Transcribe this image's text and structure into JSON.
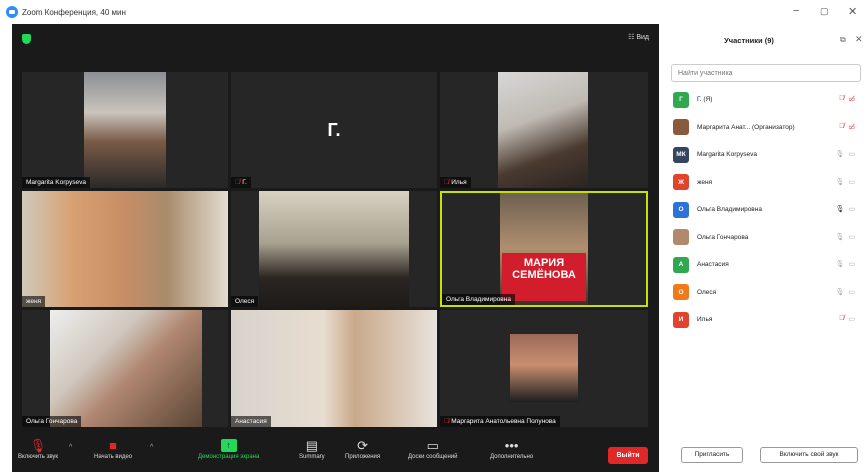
{
  "window": {
    "title": "Zoom Конференция, 40 мин"
  },
  "video_area": {
    "view_label": "Вид"
  },
  "tiles": [
    {
      "name": "Margarita Korpyseva",
      "muted": false
    },
    {
      "name": "Г.",
      "letter": "Г.",
      "muted": true
    },
    {
      "name": "Илья",
      "muted": true
    },
    {
      "name": "женя",
      "muted": false
    },
    {
      "name": "Олеся",
      "muted": false
    },
    {
      "name": "Ольга Владимировна",
      "muted": false,
      "banner_line1": "МАРИЯ",
      "banner_line2": "СЕМЁНОВА"
    },
    {
      "name": "Ольга Гончарова",
      "muted": false
    },
    {
      "name": "Анастасия",
      "muted": false
    },
    {
      "name": "Маргарита Анатольевна Полунова",
      "muted": true
    }
  ],
  "toolbar": {
    "mute": "Включить звук",
    "video": "Начать видео",
    "share": "Демонстрация экрана",
    "summary": "Summary",
    "apps": "Приложения",
    "whiteboards": "Доски сообщений",
    "more": "Дополнительно",
    "leave": "Выйти"
  },
  "panel": {
    "title": "Участники (9)",
    "search_placeholder": "Найти участника",
    "participants": [
      {
        "initials": "Г",
        "name": "Г. (Я)",
        "color": "#2fa84f",
        "mic_muted": true,
        "video_off": true
      },
      {
        "initials": "",
        "name": "Маргарита Анат... (Организатор)",
        "color": "#8a5a3c",
        "mic_muted": true,
        "video_off": true
      },
      {
        "initials": "МК",
        "name": "Margarita Korpyseva",
        "color": "#34455f",
        "mic_muted": false,
        "video_off": false
      },
      {
        "initials": "Ж",
        "name": "женя",
        "color": "#e0442c",
        "mic_muted": false,
        "video_off": false
      },
      {
        "initials": "О",
        "name": "Ольга Владимировна",
        "color": "#2d72d9",
        "mic_muted": false,
        "video_off": false
      },
      {
        "initials": "",
        "name": "Ольга Гончарова",
        "color": "#b08a6a",
        "mic_muted": false,
        "video_off": false
      },
      {
        "initials": "А",
        "name": "Анастасия",
        "color": "#2fa84f",
        "mic_muted": false,
        "video_off": false
      },
      {
        "initials": "О",
        "name": "Олеся",
        "color": "#f07a1a",
        "mic_muted": false,
        "video_off": false
      },
      {
        "initials": "И",
        "name": "Илья",
        "color": "#e0442c",
        "mic_muted": true,
        "video_off": false
      }
    ],
    "invite": "Пригласить",
    "unmute_self": "Включить свой звук"
  }
}
